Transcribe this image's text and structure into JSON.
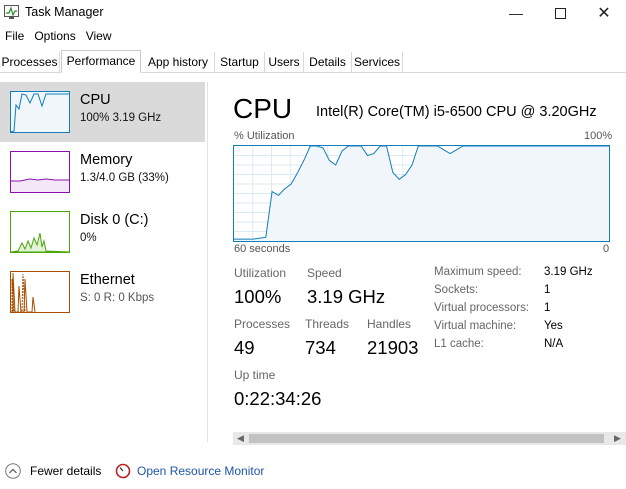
{
  "window": {
    "title": "Task Manager"
  },
  "menu": [
    "File",
    "Options",
    "View"
  ],
  "tabs": [
    "Processes",
    "Performance",
    "App history",
    "Startup",
    "Users",
    "Details",
    "Services"
  ],
  "active_tab": "Performance",
  "sidebar": {
    "items": [
      {
        "name": "CPU",
        "value": "100%  3.19 GHz",
        "color": "#117dbb"
      },
      {
        "name": "Memory",
        "value": "1.3/4.0 GB (33%)",
        "color": "#8b12ae"
      },
      {
        "name": "Disk 0 (C:)",
        "value": "0%",
        "color": "#4da60c"
      },
      {
        "name": "Ethernet",
        "value": "S: 0  R: 0 Kbps",
        "color": "#a74f01"
      }
    ]
  },
  "main": {
    "title": "CPU",
    "processor": "Intel(R) Core(TM) i5-6500 CPU @ 3.20GHz",
    "graph_label": "% Utilization",
    "graph_max": "100%",
    "graph_time": "60 seconds",
    "graph_min": "0",
    "utilization_history": [
      2,
      2,
      2,
      2,
      3,
      4,
      52,
      48,
      55,
      60,
      72,
      85,
      100,
      100,
      98,
      85,
      80,
      95,
      100,
      100,
      100,
      90,
      92,
      100,
      100,
      72,
      65,
      70,
      80,
      100,
      100,
      100,
      100,
      96,
      92,
      96,
      100,
      100,
      100,
      100,
      100,
      100,
      100,
      100,
      100,
      100,
      100,
      100,
      100,
      100,
      100,
      100,
      100,
      100,
      100,
      100,
      100,
      100,
      100,
      100
    ],
    "stats": {
      "utilization_label": "Utilization",
      "utilization": "100%",
      "speed_label": "Speed",
      "speed": "3.19 GHz",
      "processes_label": "Processes",
      "processes": "49",
      "threads_label": "Threads",
      "threads": "734",
      "handles_label": "Handles",
      "handles": "21903",
      "uptime_label": "Up time",
      "uptime": "0:22:34:26"
    },
    "details": [
      {
        "label": "Maximum speed:",
        "value": "3.19 GHz"
      },
      {
        "label": "Sockets:",
        "value": "1"
      },
      {
        "label": "Virtual processors:",
        "value": "1"
      },
      {
        "label": "Virtual machine:",
        "value": "Yes"
      },
      {
        "label": "L1 cache:",
        "value": "N/A"
      }
    ]
  },
  "footer": {
    "fewer_details": "Fewer details",
    "resource_monitor": "Open Resource Monitor"
  }
}
